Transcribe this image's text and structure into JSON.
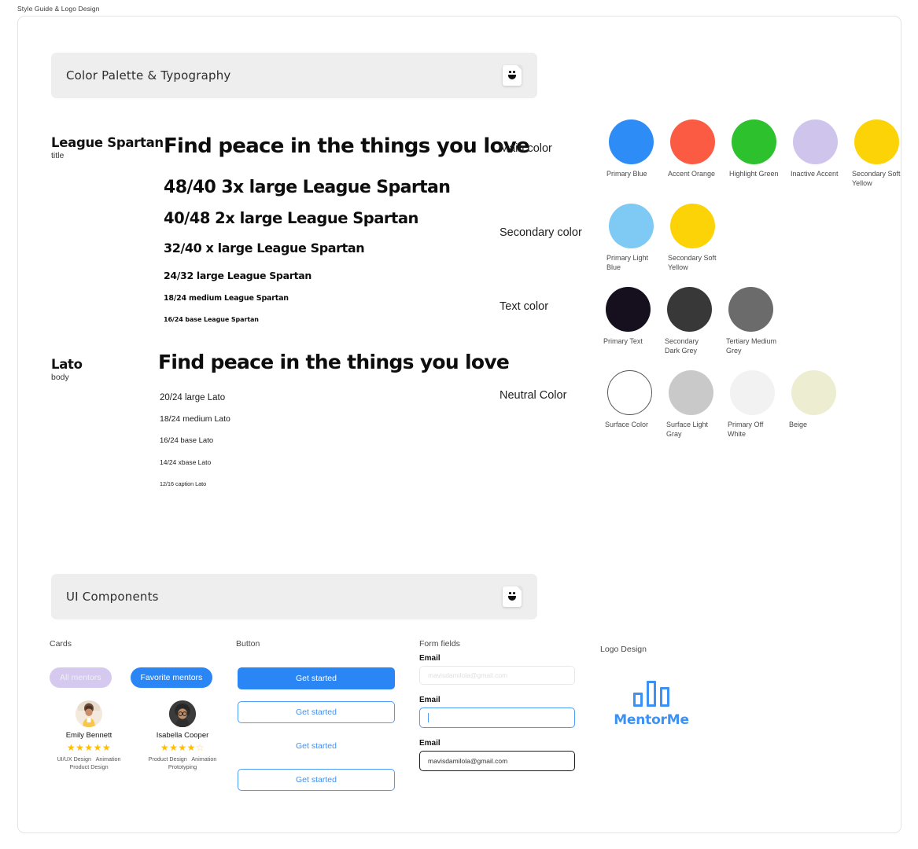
{
  "page": {
    "label": "Style Guide & Logo Design"
  },
  "sections": {
    "typography": {
      "title": "Color Palette & Typography",
      "sticker_icon": "smiley-document-icon"
    },
    "components": {
      "title": "UI Components",
      "sticker_icon": "smiley-document-icon"
    }
  },
  "typefaces": [
    {
      "name": "League Spartan",
      "role": "title",
      "sample": "Find peace in the things you love",
      "scale": [
        "48/40 3x large League Spartan",
        "40/48 2x large League Spartan",
        "32/40 x large League Spartan",
        "24/32 large League Spartan",
        "18/24 medium League Spartan",
        "16/24 base League Spartan"
      ]
    },
    {
      "name": "Lato",
      "role": "body",
      "sample": "Find peace in the things you love",
      "scale": [
        "20/24 large Lato",
        "18/24 medium Lato",
        "16/24 base Lato",
        "14/24 xbase Lato",
        "12/16 caption Lato"
      ]
    }
  ],
  "color_groups": [
    {
      "label": "Main color",
      "swatches": [
        {
          "name": "Primary Blue",
          "hex": "#2D8CF5"
        },
        {
          "name": "Accent Orange",
          "hex": "#FB5B42"
        },
        {
          "name": "Highlight Green",
          "hex": "#2EC12E"
        },
        {
          "name": "Inactive Accent",
          "hex": "#CFC4EC"
        },
        {
          "name": "Secondary Soft Yellow",
          "hex": "#FCD307"
        }
      ]
    },
    {
      "label": "Secondary color",
      "swatches": [
        {
          "name": "Primary Light Blue",
          "hex": "#7FC9F5"
        },
        {
          "name": "Secondary Soft Yellow",
          "hex": "#FCD307"
        }
      ]
    },
    {
      "label": "Text color",
      "swatches": [
        {
          "name": "Primary Text",
          "hex": "#16101E"
        },
        {
          "name": "Secondary Dark Grey",
          "hex": "#383838"
        },
        {
          "name": "Tertiary Medium Grey",
          "hex": "#6B6B6B"
        }
      ]
    },
    {
      "label": "Neutral Color",
      "swatches": [
        {
          "name": "Surface Color",
          "hex": "#FFFFFF",
          "border": "#555555"
        },
        {
          "name": "Surface Light Gray",
          "hex": "#C9C9C9"
        },
        {
          "name": "Primary Off White",
          "hex": "#F2F2F3"
        },
        {
          "name": "Beige",
          "hex": "#EDEDD2"
        }
      ]
    }
  ],
  "components": {
    "cards": {
      "label": "Cards",
      "pills": [
        {
          "text": "All mentors",
          "state": "inactive"
        },
        {
          "text": "Favorite mentors",
          "state": "active"
        }
      ],
      "mentors": [
        {
          "name": "Emily Bennett",
          "rating": 5,
          "max_rating": 5,
          "tags": [
            "UI/UX Design",
            "Animation",
            "Product Design"
          ],
          "avatar_icon": "avatar-photo"
        },
        {
          "name": "Isabella Cooper",
          "rating": 4,
          "max_rating": 5,
          "tags": [
            "Product Design",
            "Animation",
            "Prototyping"
          ],
          "avatar_icon": "avatar-photo"
        }
      ]
    },
    "buttons": {
      "label": "Button",
      "items": [
        {
          "text": "Get started",
          "variant": "filled"
        },
        {
          "text": "Get started",
          "variant": "outline"
        },
        {
          "text": "Get started",
          "variant": "text"
        },
        {
          "text": "Get started",
          "variant": "outline"
        }
      ]
    },
    "form_fields": {
      "label": "Form fields",
      "fields": [
        {
          "label": "Email",
          "placeholder": "mavisdamilola@gmail.com",
          "value": "",
          "state": "ghost"
        },
        {
          "label": "Email",
          "placeholder": "",
          "value": "",
          "state": "focus"
        },
        {
          "label": "Email",
          "placeholder": "",
          "value": "mavisdamilola@gmail.com",
          "state": "filled"
        }
      ]
    },
    "logo": {
      "label": "Logo Design",
      "wordmark": "MentorMe",
      "mark_icon": "bar-chart-logo-icon",
      "color": "#3D91F3"
    }
  }
}
